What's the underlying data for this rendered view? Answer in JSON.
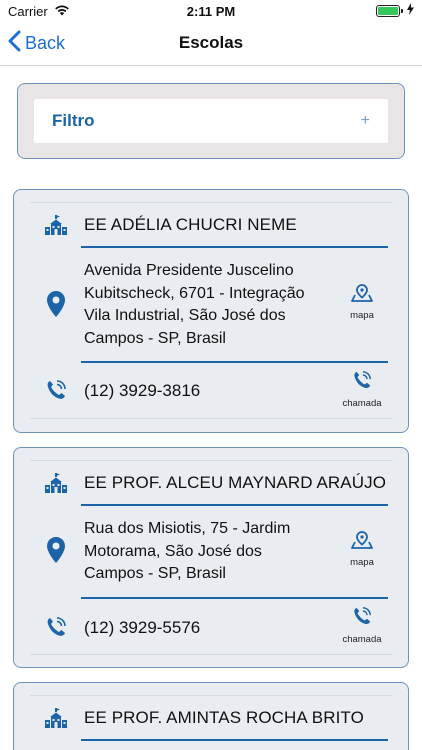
{
  "status_bar": {
    "carrier": "Carrier",
    "time": "2:11 PM"
  },
  "nav": {
    "back_label": "Back",
    "title": "Escolas"
  },
  "filter": {
    "label": "Filtro",
    "expand_symbol": "+"
  },
  "actions": {
    "map_label": "mapa",
    "call_label": "chamada"
  },
  "schools": [
    {
      "name": "EE ADÉLIA CHUCRI NEME",
      "address_lines": [
        "Avenida Presidente Juscelino",
        "Kubitscheck, 6701 - Integração",
        "Vila Industrial, São José dos",
        "Campos - SP, Brasil"
      ],
      "phone": "(12) 3929-3816"
    },
    {
      "name": "EE PROF. ALCEU MAYNARD ARAÚJO",
      "address_lines": [
        "Rua dos Misiotis, 75 - Jardim",
        "Motorama, São José dos",
        "Campos - SP, Brasil"
      ],
      "phone": "(12) 3929-5576"
    },
    {
      "name": "EE PROF. AMINTAS ROCHA BRITO"
    }
  ],
  "colors": {
    "accent": "#1c64a8",
    "ios_blue": "#1c6fd6",
    "card_bg": "#e9edf1",
    "card_border": "#6f93bd",
    "battery": "#34c759"
  }
}
